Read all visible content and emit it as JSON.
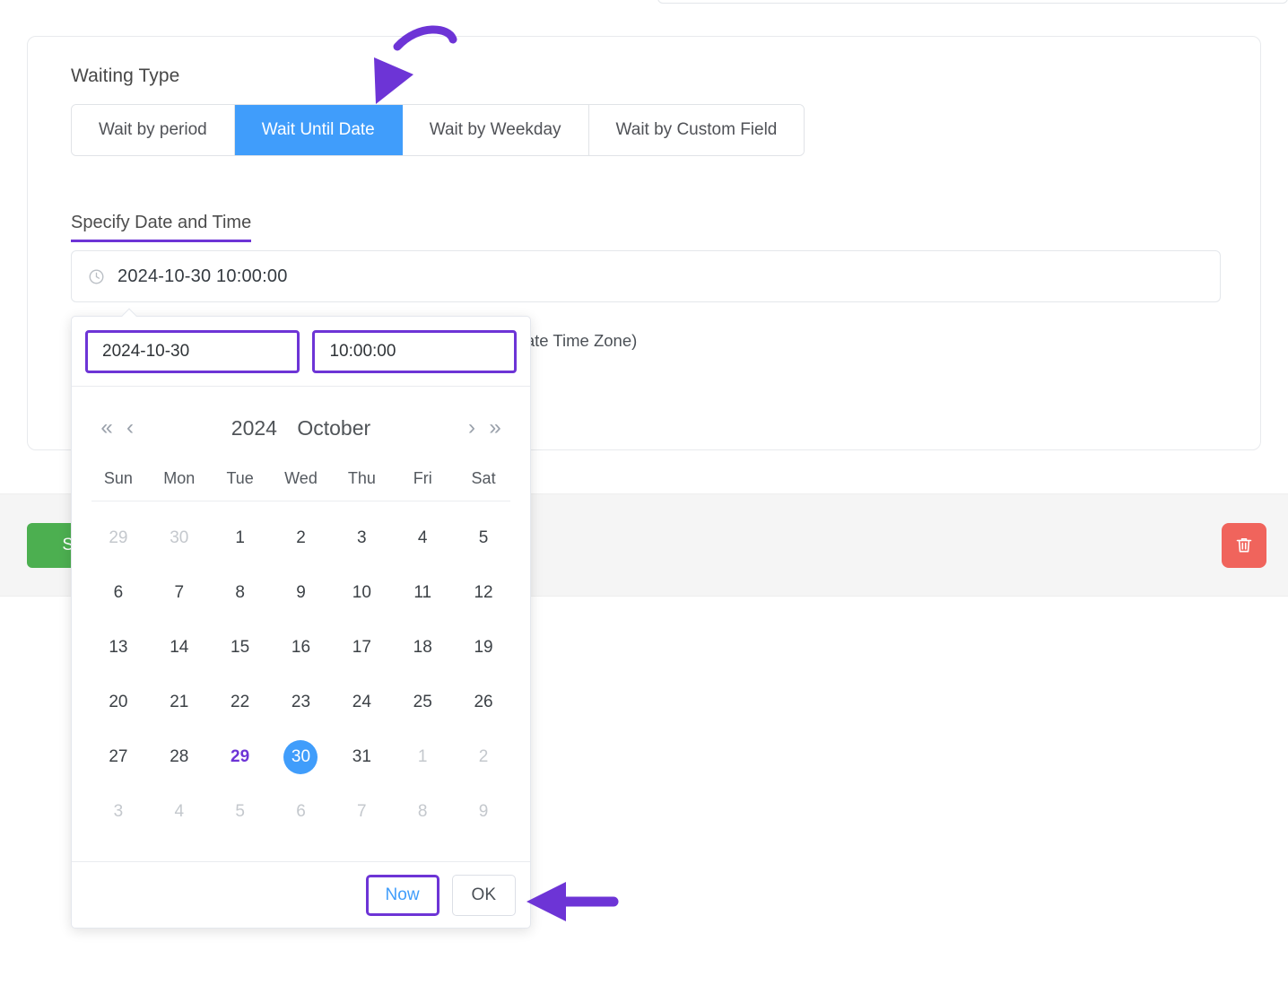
{
  "top_textarea": {
    "resize_handle": "resize-grip"
  },
  "card": {
    "section_title": "Waiting Type",
    "tabs": [
      {
        "label": "Wait by period",
        "active": false
      },
      {
        "label": "Wait Until Date",
        "active": true
      },
      {
        "label": "Wait by Weekday",
        "active": false
      },
      {
        "label": "Wait by Custom Field",
        "active": false
      }
    ],
    "field_label": "Specify Date and Time",
    "datetime_value": "2024-10-30 10:00:00",
    "datetime_icon": "clock-icon",
    "helper_text": "ted after that time (TimeZone will be as per your WordPress Date Time Zone)"
  },
  "action_bar": {
    "save_label": "Sa",
    "save_color": "#4caf50",
    "delete_icon": "trash-icon",
    "delete_color": "#f0645c"
  },
  "picker": {
    "date_value": "2024-10-30",
    "time_value": "10:00:00",
    "nav": {
      "prev_year": "«",
      "prev_month": "‹",
      "next_month": "›",
      "next_year": "»"
    },
    "year": "2024",
    "month": "October",
    "weekdays": [
      "Sun",
      "Mon",
      "Tue",
      "Wed",
      "Thu",
      "Fri",
      "Sat"
    ],
    "days": [
      {
        "d": "29",
        "state": "muted"
      },
      {
        "d": "30",
        "state": "muted"
      },
      {
        "d": "1",
        "state": "normal"
      },
      {
        "d": "2",
        "state": "normal"
      },
      {
        "d": "3",
        "state": "normal"
      },
      {
        "d": "4",
        "state": "normal"
      },
      {
        "d": "5",
        "state": "normal"
      },
      {
        "d": "6",
        "state": "normal"
      },
      {
        "d": "7",
        "state": "normal"
      },
      {
        "d": "8",
        "state": "normal"
      },
      {
        "d": "9",
        "state": "normal"
      },
      {
        "d": "10",
        "state": "normal"
      },
      {
        "d": "11",
        "state": "normal"
      },
      {
        "d": "12",
        "state": "normal"
      },
      {
        "d": "13",
        "state": "normal"
      },
      {
        "d": "14",
        "state": "normal"
      },
      {
        "d": "15",
        "state": "normal"
      },
      {
        "d": "16",
        "state": "normal"
      },
      {
        "d": "17",
        "state": "normal"
      },
      {
        "d": "18",
        "state": "normal"
      },
      {
        "d": "19",
        "state": "normal"
      },
      {
        "d": "20",
        "state": "normal"
      },
      {
        "d": "21",
        "state": "normal"
      },
      {
        "d": "22",
        "state": "normal"
      },
      {
        "d": "23",
        "state": "normal"
      },
      {
        "d": "24",
        "state": "normal"
      },
      {
        "d": "25",
        "state": "normal"
      },
      {
        "d": "26",
        "state": "normal"
      },
      {
        "d": "27",
        "state": "normal"
      },
      {
        "d": "28",
        "state": "normal"
      },
      {
        "d": "29",
        "state": "today"
      },
      {
        "d": "30",
        "state": "selected"
      },
      {
        "d": "31",
        "state": "normal"
      },
      {
        "d": "1",
        "state": "muted"
      },
      {
        "d": "2",
        "state": "muted"
      },
      {
        "d": "3",
        "state": "muted"
      },
      {
        "d": "4",
        "state": "muted"
      },
      {
        "d": "5",
        "state": "muted"
      },
      {
        "d": "6",
        "state": "muted"
      },
      {
        "d": "7",
        "state": "muted"
      },
      {
        "d": "8",
        "state": "muted"
      },
      {
        "d": "9",
        "state": "muted"
      }
    ],
    "now_label": "Now",
    "ok_label": "OK"
  },
  "annotations": {
    "arrow_color": "#6d34d6",
    "arrow_to_tab": "curved-arrow-icon",
    "arrow_to_ok": "straight-arrow-icon"
  },
  "colors": {
    "accent_blue": "#409dfb",
    "highlight_purple": "#6d34d6",
    "save_green": "#4caf50",
    "delete_red": "#f0645c"
  }
}
